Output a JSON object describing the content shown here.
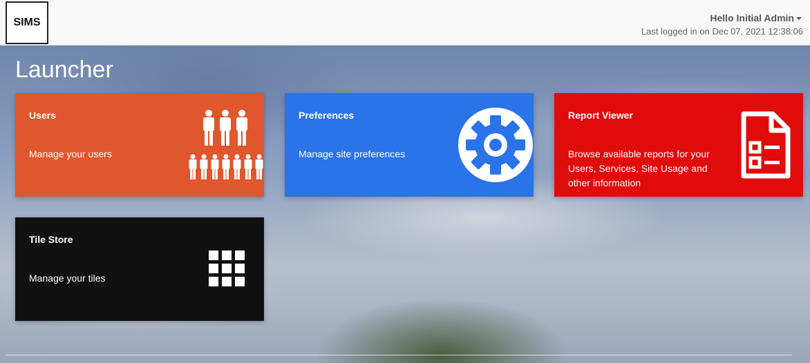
{
  "header": {
    "logo_text": "SIMS",
    "user_greeting": "Hello Initial Admin",
    "last_login": "Last logged in on Dec 07, 2021 12:38:06"
  },
  "page": {
    "title": "Launcher"
  },
  "tiles": [
    {
      "title": "Users",
      "description": "Manage your users",
      "color": "#e0562d",
      "icon": "users-icon"
    },
    {
      "title": "Preferences",
      "description": "Manage site preferences",
      "color": "#2a73e8",
      "icon": "gear-icon"
    },
    {
      "title": "Report Viewer",
      "description": "Browse available reports for your Users, Services, Site Usage and other information",
      "color": "#e00b0b",
      "icon": "report-icon"
    },
    {
      "title": "Tile Store",
      "description": "Manage your tiles",
      "color": "#111111",
      "icon": "grid-icon"
    }
  ]
}
